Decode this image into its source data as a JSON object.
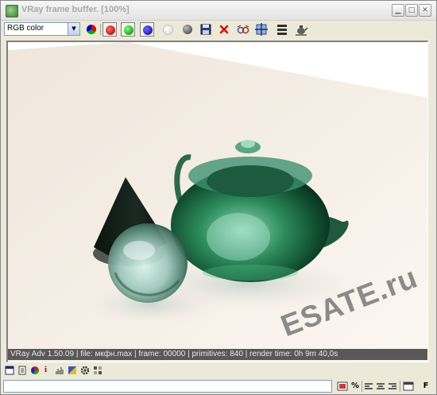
{
  "window": {
    "title": "VRay frame buffer. [100%]",
    "controls": [
      "minimize",
      "maximize",
      "close"
    ]
  },
  "toolbar": {
    "channel_select": {
      "value": "RGB color"
    },
    "buttons": [
      {
        "name": "display-all-channels",
        "icon": "rgb-wheel-icon"
      },
      {
        "name": "red-channel",
        "icon": "red-dot-icon",
        "color": "#b00000"
      },
      {
        "name": "green-channel",
        "icon": "green-dot-icon",
        "color": "#00a000"
      },
      {
        "name": "blue-channel",
        "icon": "blue-dot-icon",
        "color": "#0000b0"
      },
      {
        "name": "alpha-channel",
        "icon": "white-dot-icon"
      },
      {
        "name": "monochrome",
        "icon": "gray-dot-icon"
      },
      {
        "name": "save-image",
        "icon": "floppy-disk-icon"
      },
      {
        "name": "clear-image",
        "icon": "red-x-icon"
      },
      {
        "name": "duplicate-to-mtl",
        "icon": "glasses-icon"
      },
      {
        "name": "track-mouse",
        "icon": "crosshair-icon"
      },
      {
        "name": "show-history",
        "icon": "stack-icon"
      },
      {
        "name": "render-settings",
        "icon": "teapot-icon"
      }
    ]
  },
  "render_info": "VRay Adv 1.50.09 | file: мкфн.max | frame: 00000 | primitives: 840 | render time: 0h 9m 40,0s",
  "watermark": "ESATE.ru",
  "bottom_toolbar": {
    "left_icons": [
      "window-icon",
      "document-icon",
      "color-wheel-icon",
      "info-icon",
      "levels-icon",
      "gradient-icon",
      "gear-icon",
      "pixel-grid-icon"
    ],
    "right_labels": {
      "percent": "%",
      "f": "F"
    },
    "right_icons": [
      "picture-icon",
      "align-left-icon",
      "align-center-icon",
      "align-right-icon",
      "window-small-icon"
    ]
  }
}
